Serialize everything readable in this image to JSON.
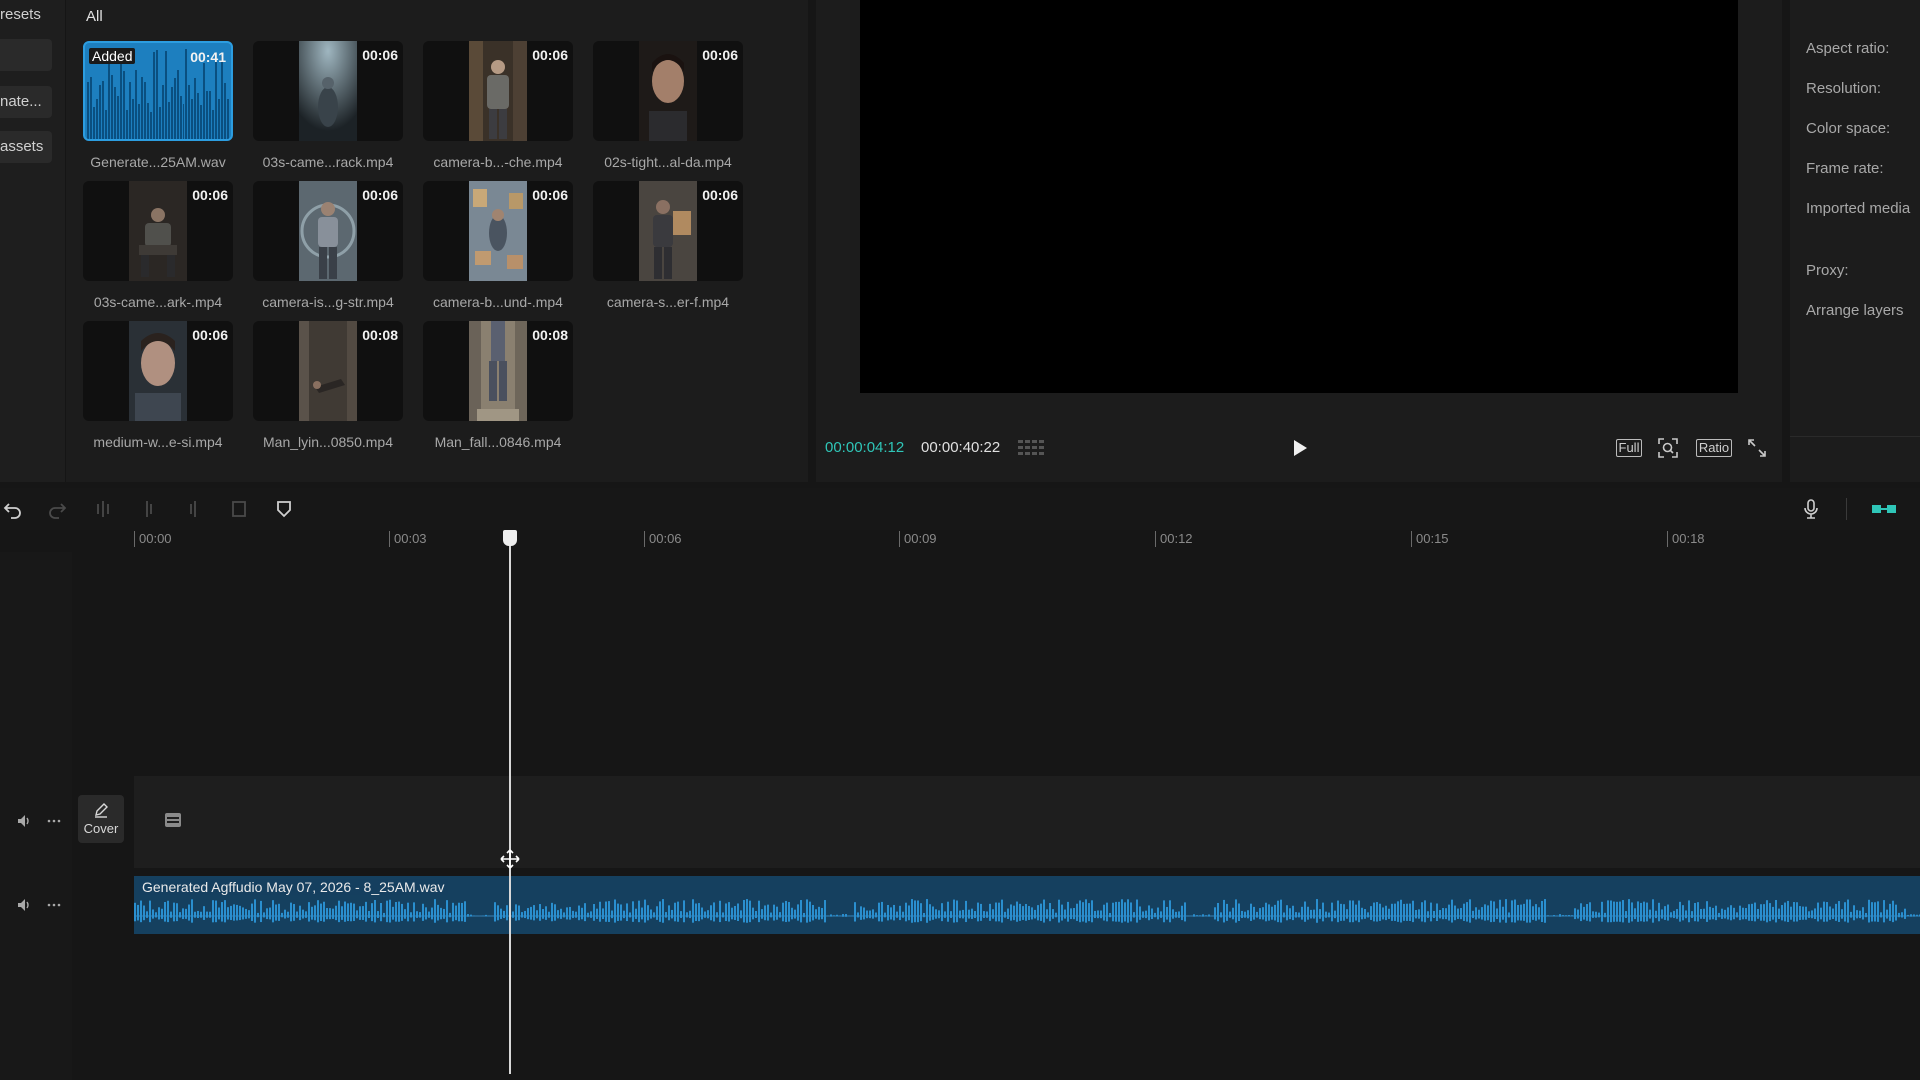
{
  "left_panel": {
    "items": [
      {
        "label": "resets"
      },
      {
        "label": "nate..."
      },
      {
        "label": "assets"
      }
    ]
  },
  "media": {
    "filter": "All",
    "items": [
      {
        "name": "Generate...25AM.wav",
        "duration": "00:41",
        "badge": "Added",
        "type": "audio"
      },
      {
        "name": "03s-came...rack.mp4",
        "duration": "00:06",
        "type": "video"
      },
      {
        "name": "camera-b...-che.mp4",
        "duration": "00:06",
        "type": "video"
      },
      {
        "name": "02s-tight...al-da.mp4",
        "duration": "00:06",
        "type": "video"
      },
      {
        "name": "03s-came...ark-.mp4",
        "duration": "00:06",
        "type": "video"
      },
      {
        "name": "camera-is...g-str.mp4",
        "duration": "00:06",
        "type": "video"
      },
      {
        "name": "camera-b...und-.mp4",
        "duration": "00:06",
        "type": "video"
      },
      {
        "name": "camera-s...er-f.mp4",
        "duration": "00:06",
        "type": "video"
      },
      {
        "name": "medium-w...e-si.mp4",
        "duration": "00:06",
        "type": "video"
      },
      {
        "name": "Man_lyin...0850.mp4",
        "duration": "00:08",
        "type": "video"
      },
      {
        "name": "Man_fall...0846.mp4",
        "duration": "00:08",
        "type": "video"
      }
    ]
  },
  "player": {
    "current_time": "00:00:04:12",
    "total_time": "00:00:40:22",
    "full_label": "Full",
    "ratio_label": "Ratio"
  },
  "details": {
    "labels": [
      "Aspect ratio:",
      "Resolution:",
      "Color space:",
      "Frame rate:",
      "Imported media",
      "Proxy:",
      "Arrange layers"
    ]
  },
  "timeline": {
    "ruler_ticks": [
      "00:00",
      "00:03",
      "00:06",
      "00:09",
      "00:12",
      "00:15",
      "00:18"
    ],
    "cover_label": "Cover",
    "audio_clip_label": "Generated Agffudio May 07, 2026 - 8_25AM.wav",
    "playhead_time_seconds": 4.4
  },
  "colors": {
    "accent": "#2fc6b8",
    "audio_clip": "#15405f",
    "audio_wave": "#2a8fcf",
    "background": "#161616"
  }
}
